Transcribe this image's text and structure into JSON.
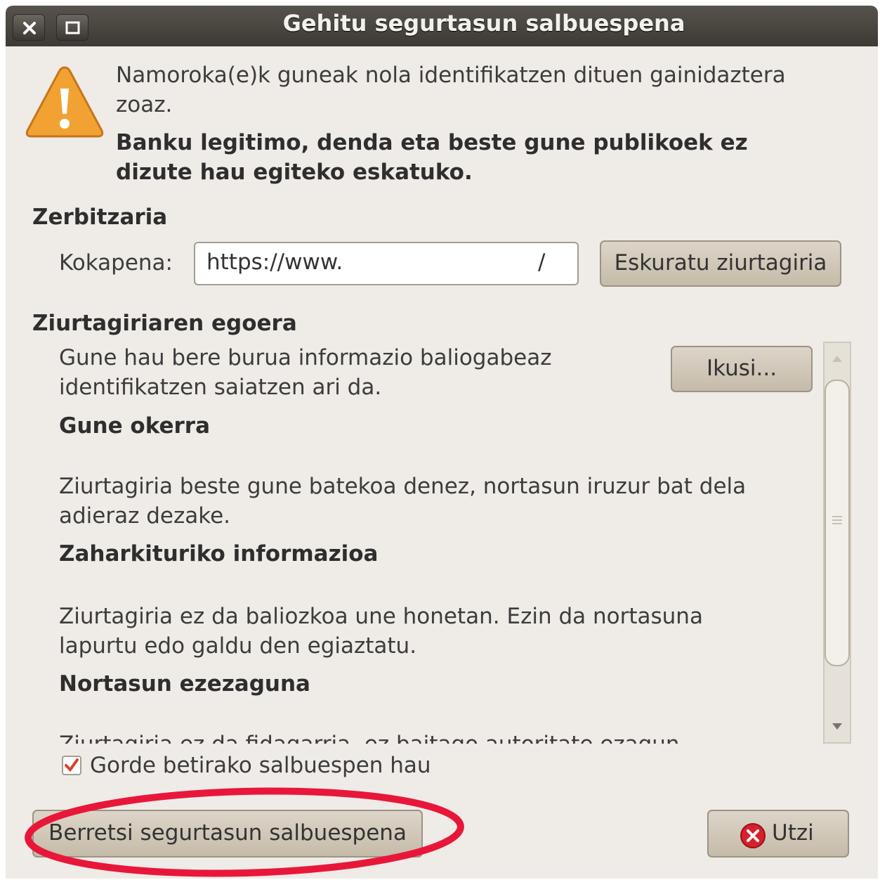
{
  "window": {
    "title": "Gehitu segurtasun salbuespena"
  },
  "warning": {
    "line1": "Namoroka(e)k guneak nola identifikatzen dituen gainidaztera",
    "line2": "zoaz.",
    "bold_line1": "Banku legitimo, denda eta beste gune publikoek ez",
    "bold_line2": "dizute hau egiteko eskatuko."
  },
  "server": {
    "heading": "Zerbitzaria",
    "location_label": "Kokapena:",
    "location_value": "https://www.",
    "location_slash": "/",
    "get_cert_button": "Eskuratu ziurtagiria"
  },
  "status": {
    "heading": "Ziurtagiriaren egoera",
    "intro_line1": "Gune hau bere burua informazio baliogabeaz",
    "intro_line2": "identifikatzen saiatzen ari da.",
    "view_button": "Ikusi...",
    "wrong_site_title": "Gune okerra",
    "wrong_site_line1": "Ziurtagiria beste gune batekoa denez, nortasun iruzur bat dela",
    "wrong_site_line2": "adieraz dezake.",
    "outdated_title": "Zaharkituriko informazioa",
    "outdated_line1": "Ziurtagiria ez da baliozkoa une honetan. Ezin da nortasuna",
    "outdated_line2": "lapurtu edo galdu den egiaztatu.",
    "unknown_title": "Nortasun ezezaguna",
    "unknown_line1": "Ziurtagiria ez da fidagarria, ez baitago autoritate ezagun"
  },
  "permanent": {
    "label": "Gorde betirako salbuespen hau",
    "checked": true
  },
  "buttons": {
    "confirm": "Berretsi segurtasun salbuespena",
    "cancel": "Utzi"
  },
  "colors": {
    "highlight_ellipse": "#e8173a",
    "warning_triangle": "#f0a030",
    "titlebar": "#4a4741"
  }
}
